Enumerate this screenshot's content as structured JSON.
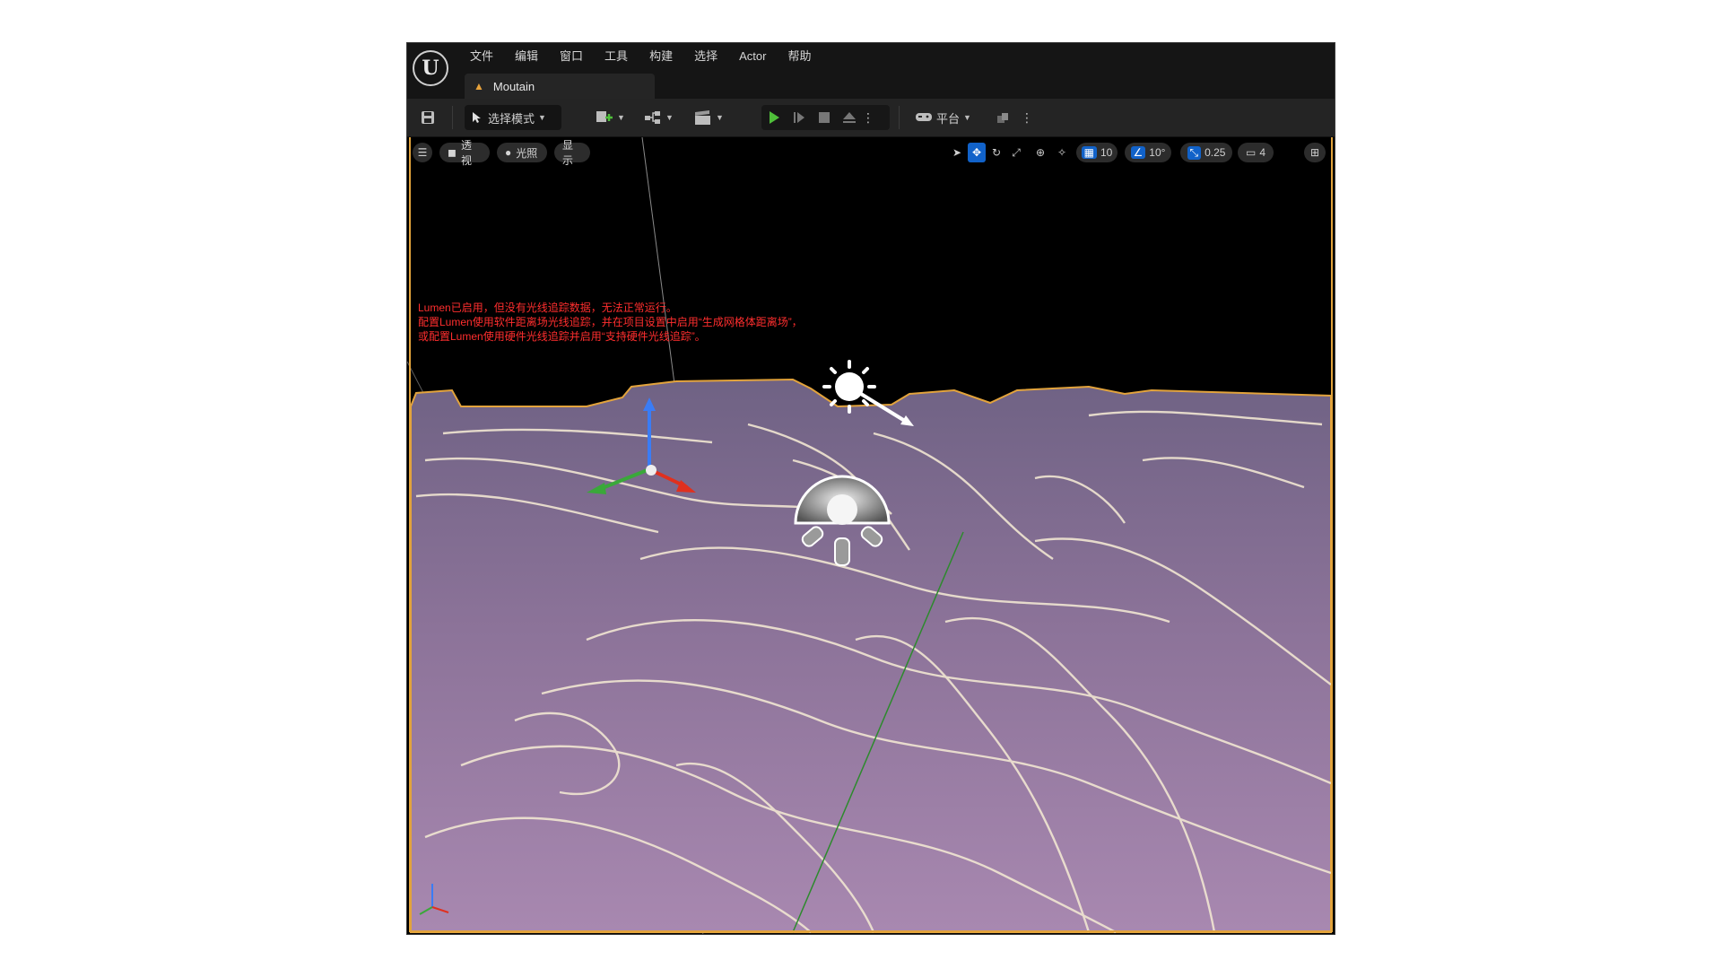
{
  "menu": {
    "items": [
      "文件",
      "编辑",
      "窗口",
      "工具",
      "构建",
      "选择",
      "Actor",
      "帮助"
    ]
  },
  "logo_text": "U",
  "tab": {
    "label": "Moutain"
  },
  "toolbar": {
    "mode_label": "选择模式",
    "platform_label": "平台"
  },
  "viewport": {
    "perspective_label": "透视",
    "lighting_label": "光照",
    "show_label": "显示",
    "grid_snap_value": "10",
    "rotate_snap_value": "10°",
    "scale_snap_value": "0.25",
    "camera_speed_value": "4"
  },
  "warning": {
    "line1": "Lumen已启用，但没有光线追踪数据，无法正常运行。",
    "line2": "配置Lumen使用软件距离场光线追踪，并在项目设置中启用“生成网格体距离场”，",
    "line3": "或配置Lumen使用硬件光线追踪并启用“支持硬件光线追踪”。"
  },
  "colors": {
    "accent_blue": "#1162c9",
    "play_green": "#4fbf3a",
    "selection_orange": "#e2a33c",
    "warning_red": "#ff2e2e",
    "terrain_purple": "#9b7fa8"
  }
}
